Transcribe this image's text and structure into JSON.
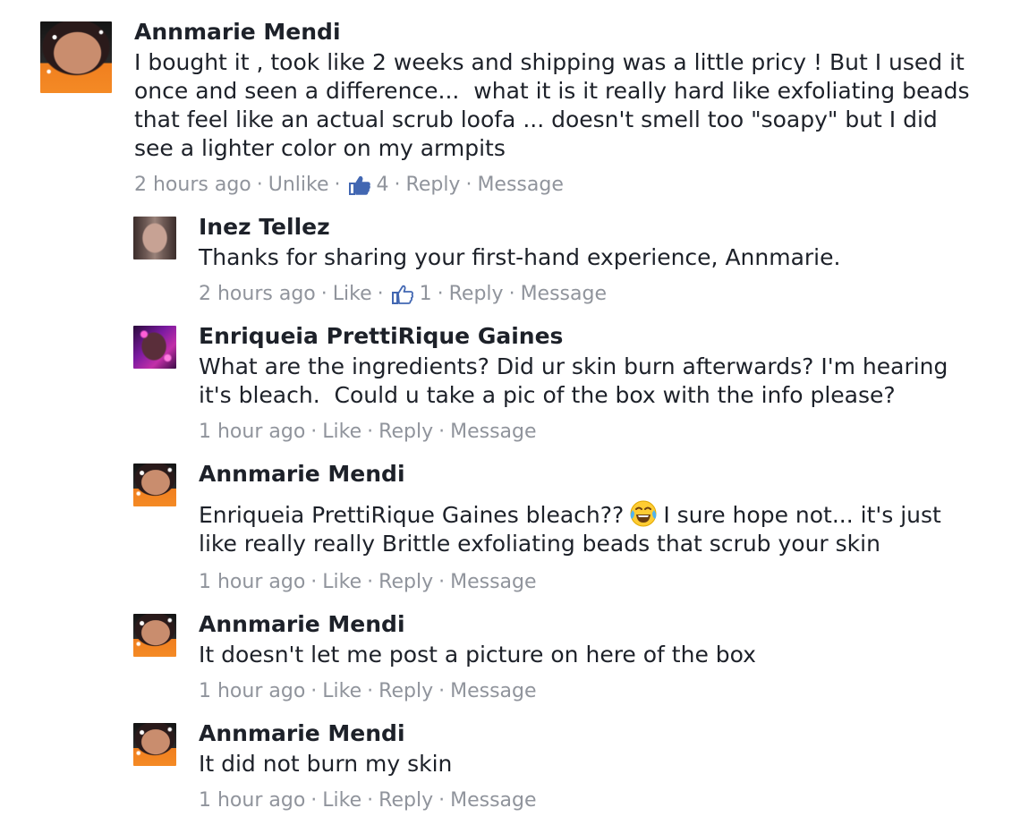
{
  "comments": [
    {
      "author": "Annmarie Mendi",
      "text": "I bought it , took like 2 weeks and shipping was a little pricy ! But I used it\nonce and seen a difference...  what it is it really hard like exfoliating beads\nthat feel like an actual scrub loofa ... doesn't smell too \"soapy\" but I did\nsee a lighter color on my armpits",
      "time": "2 hours ago",
      "like_label": "Unlike",
      "like_count": "4",
      "reply_label": "Reply",
      "message_label": "Message"
    },
    {
      "author": "Inez Tellez",
      "text": "Thanks for sharing your first-hand experience, Annmarie.",
      "time": "2 hours ago",
      "like_label": "Like",
      "like_count": "1",
      "reply_label": "Reply",
      "message_label": "Message"
    },
    {
      "author": "Enriqueia PrettiRique Gaines",
      "text": "What are the ingredients? Did ur skin burn afterwards? I'm hearing\nit's bleach.  Could u take a pic of the box with the info please?",
      "time": "1 hour ago",
      "like_label": "Like",
      "reply_label": "Reply",
      "message_label": "Message"
    },
    {
      "author": "Annmarie Mendi",
      "text_before_emoji": "Enriqueia PrettiRique Gaines bleach??",
      "emoji": "face-with-tears-of-joy",
      "text_after_emoji": "I sure hope not... it's just\nlike really really Brittle exfoliating beads that scrub your skin",
      "time": "1 hour ago",
      "like_label": "Like",
      "reply_label": "Reply",
      "message_label": "Message"
    },
    {
      "author": "Annmarie Mendi",
      "text": "It doesn't let me post a picture on here of the box",
      "time": "1 hour ago",
      "like_label": "Like",
      "reply_label": "Reply",
      "message_label": "Message"
    },
    {
      "author": "Annmarie Mendi",
      "text": "It did not burn my skin",
      "time": "1 hour ago",
      "like_label": "Like",
      "reply_label": "Reply",
      "message_label": "Message"
    }
  ],
  "colors": {
    "text": "#1d2129",
    "meta": "#90949c",
    "like_blue": "#4267b2"
  },
  "icons": [
    "thumbs-up-icon",
    "face-with-tears-of-joy-emoji"
  ]
}
